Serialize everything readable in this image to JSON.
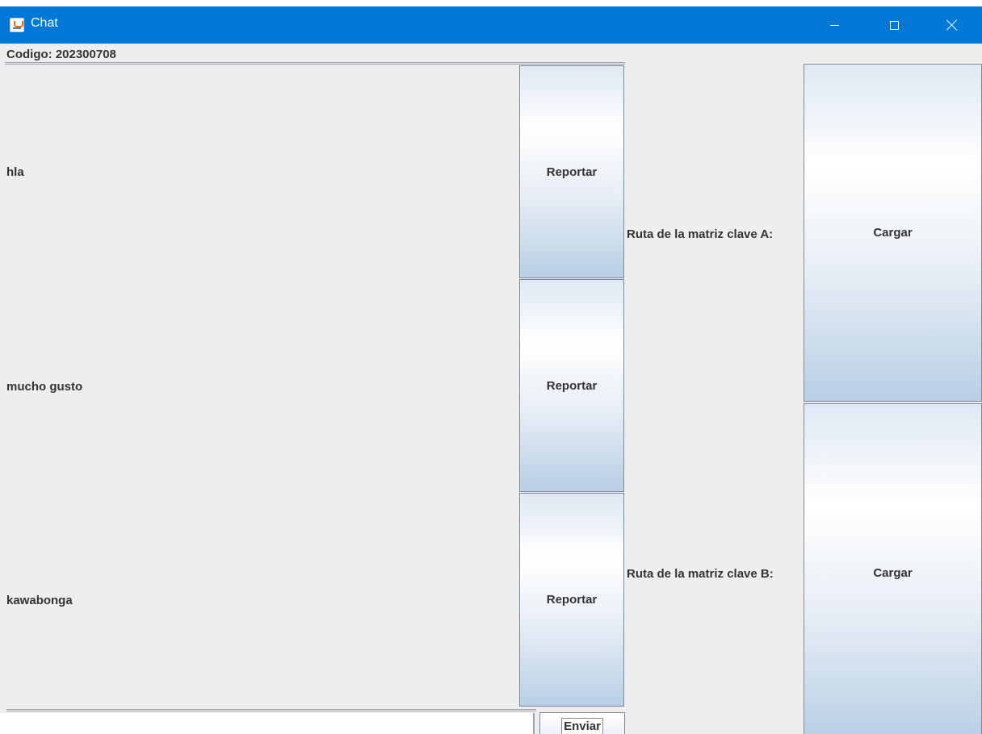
{
  "window": {
    "title": "Chat",
    "accent_color": "#0078d7",
    "icons": [
      "java-app-icon",
      "minimize-icon",
      "maximize-icon",
      "close-icon"
    ]
  },
  "header": {
    "code_label": "Codigo: 202300708"
  },
  "messages": [
    {
      "text": "hla",
      "action_label": "Reportar"
    },
    {
      "text": "mucho gusto",
      "action_label": "Reportar"
    },
    {
      "text": "kawabonga",
      "action_label": "Reportar"
    }
  ],
  "keys": [
    {
      "label": "Ruta de la matriz clave A:",
      "button_label": "Cargar"
    },
    {
      "label": "Ruta de la matriz clave B:",
      "button_label": "Cargar"
    }
  ],
  "composer": {
    "input_value": "",
    "send_label": "Enviar"
  }
}
